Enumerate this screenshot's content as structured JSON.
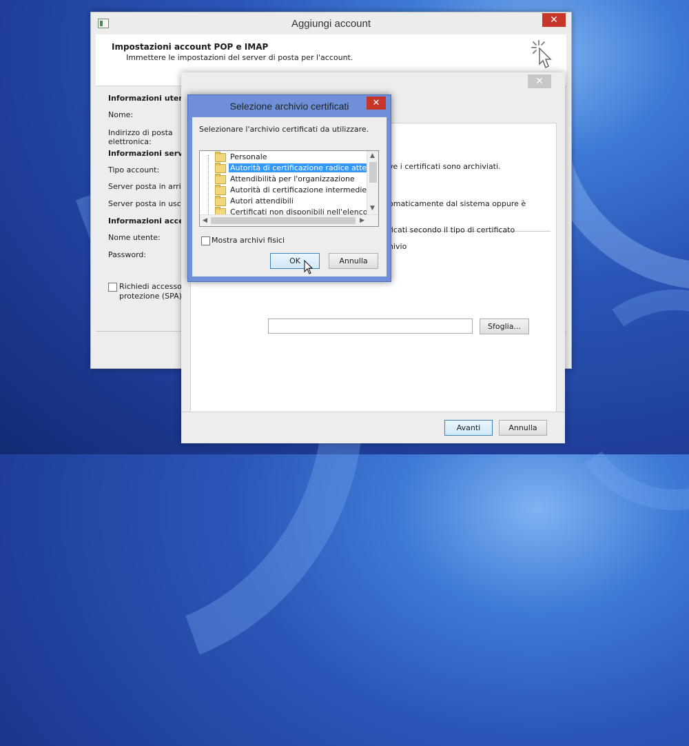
{
  "main_window": {
    "title": "Aggiungi account",
    "close_glyph": "✕",
    "header": {
      "title": "Impostazioni account POP e IMAP",
      "subtitle": "Immettere le impostazioni del server di posta per l'account."
    },
    "form": {
      "user_info_heading": "Informazioni utente",
      "name_label": "Nome:",
      "email_label_line1": "Indirizzo di posta",
      "email_label_line2": "elettronica:",
      "server_info_heading": "Informazioni server",
      "account_type_label": "Tipo account:",
      "incoming_label": "Server posta in arrivo",
      "outgoing_label": "Server posta in uscita",
      "logon_info_heading": "Informazioni accesso",
      "username_label": "Nome utente:",
      "password_label": "Password:",
      "spa_label_line1": "Richiedi accesso c",
      "spa_label_line2": "protezione (SPA)"
    }
  },
  "advanced_window": {
    "close_glyph": "✕",
    "text_line1": "ve i certificati sono archiviati.",
    "text_line2": "omaticamente dal sistema oppure è",
    "text_line3": "ficati secondo il tipo di certificato",
    "text_line4": "hivio",
    "browse_button": "Sfoglia...",
    "next_button": "Avanti",
    "cancel_button": "Annulla"
  },
  "cert_dialog": {
    "title": "Selezione archivio certificati",
    "close_glyph": "✕",
    "prompt": "Selezionare l'archivio certificati da utilizzare.",
    "stores": [
      "Personale",
      "Autorità di certificazione radice attendibili",
      "Attendibilità per l'organizzazione",
      "Autorità di certificazione intermedie",
      "Autori attendibili",
      "Certificati non disponibili nell'elenco locale"
    ],
    "selected_index": 1,
    "show_physical_label": "Mostra archivi fisici",
    "ok_button": "OK",
    "cancel_button": "Annulla"
  }
}
